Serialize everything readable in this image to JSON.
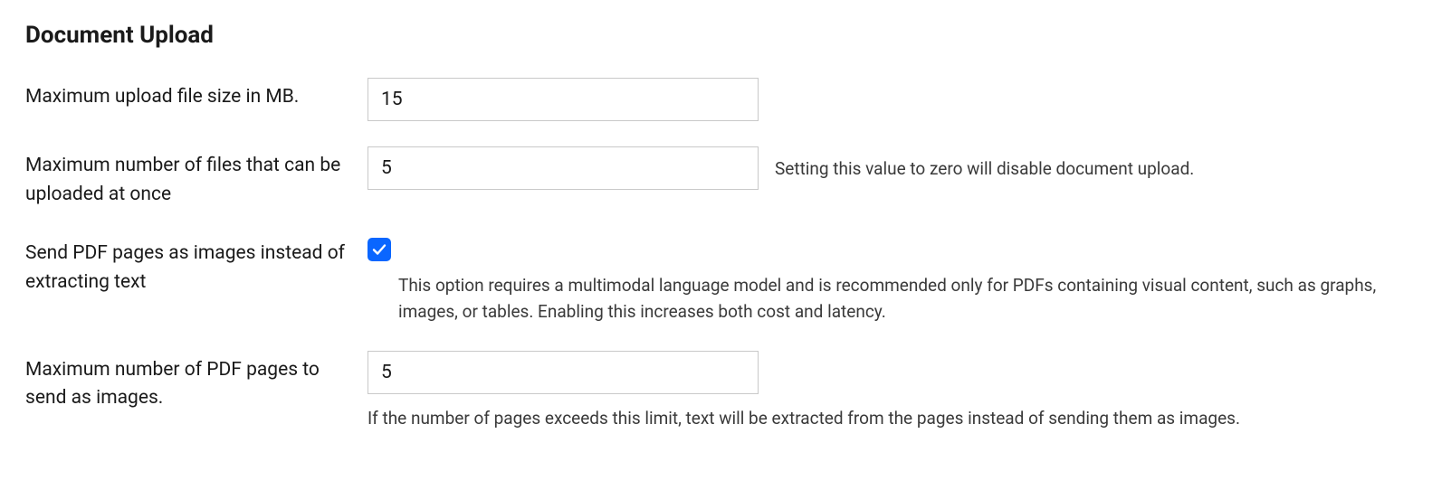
{
  "section": {
    "title": "Document Upload"
  },
  "settings": {
    "max_upload_size": {
      "label": "Maximum upload file size in MB.",
      "value": "15"
    },
    "max_files": {
      "label": "Maximum number of files that can be uploaded at once",
      "value": "5",
      "help": "Setting this value to zero will disable document upload."
    },
    "pdf_as_images": {
      "label": "Send PDF pages as images instead of extracting text",
      "checked": true,
      "help": "This option requires a multimodal language model and is recommended only for PDFs containing visual content, such as graphs, images, or tables. Enabling this increases both cost and latency."
    },
    "max_pdf_pages": {
      "label": "Maximum number of PDF pages to send as images.",
      "value": "5",
      "help": "If the number of pages exceeds this limit, text will be extracted from the pages instead of sending them as images."
    }
  }
}
